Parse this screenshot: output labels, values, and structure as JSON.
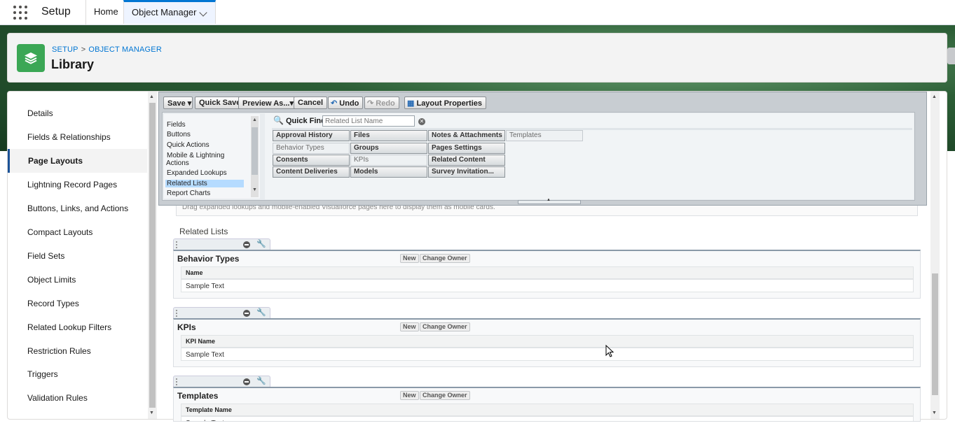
{
  "topbar": {
    "app_name": "Setup",
    "tabs": [
      {
        "label": "Home"
      },
      {
        "label": "Object Manager"
      }
    ]
  },
  "header": {
    "breadcrumb": [
      "SETUP",
      "OBJECT MANAGER"
    ],
    "breadcrumb_sep": ">",
    "title": "Library",
    "icon": "layers-icon"
  },
  "sidebar": {
    "items": [
      {
        "label": "Details"
      },
      {
        "label": "Fields & Relationships"
      },
      {
        "label": "Page Layouts",
        "active": true
      },
      {
        "label": "Lightning Record Pages"
      },
      {
        "label": "Buttons, Links, and Actions"
      },
      {
        "label": "Compact Layouts"
      },
      {
        "label": "Field Sets"
      },
      {
        "label": "Object Limits"
      },
      {
        "label": "Record Types"
      },
      {
        "label": "Related Lookup Filters"
      },
      {
        "label": "Restriction Rules"
      },
      {
        "label": "Triggers"
      },
      {
        "label": "Validation Rules"
      }
    ]
  },
  "palette": {
    "toolbar": {
      "save": "Save",
      "quick_save": "Quick Save",
      "preview_as": "Preview As...",
      "cancel": "Cancel",
      "undo": "Undo",
      "redo": "Redo",
      "layout_properties": "Layout Properties"
    },
    "categories": [
      {
        "label": "Fields"
      },
      {
        "label": "Buttons"
      },
      {
        "label": "Quick Actions"
      },
      {
        "label": "Mobile & Lightning"
      },
      {
        "label": "Actions"
      },
      {
        "label": "Expanded Lookups"
      },
      {
        "label": "Related Lists",
        "selected": true
      },
      {
        "label": "Report Charts"
      }
    ],
    "quick_find": {
      "label": "Quick Find",
      "placeholder": "Related List Name"
    },
    "items": [
      {
        "label": "Approval History",
        "used": false
      },
      {
        "label": "Files",
        "used": false
      },
      {
        "label": "Notes & Attachments",
        "used": false
      },
      {
        "label": "Templates",
        "used": true
      },
      {
        "label": "Behavior Types",
        "used": true
      },
      {
        "label": "Groups",
        "used": false
      },
      {
        "label": "Pages Settings",
        "used": false
      },
      {
        "label": "Consents",
        "used": false
      },
      {
        "label": "KPIs",
        "used": true
      },
      {
        "label": "Related Content",
        "used": false
      },
      {
        "label": "Content Deliveries",
        "used": false
      },
      {
        "label": "Models",
        "used": false
      },
      {
        "label": "Survey Invitation...",
        "used": false
      }
    ],
    "hint_text": "Drag expanded lookups and mobile-enabled Visualforce pages here to display them as mobile cards."
  },
  "layout": {
    "related_lists_heading": "Related Lists",
    "sections": [
      {
        "title": "Behavior Types",
        "column": "Name",
        "value": "Sample Text",
        "new_label": "New",
        "change_owner_label": "Change Owner"
      },
      {
        "title": "KPIs",
        "column": "KPI Name",
        "value": "Sample Text",
        "new_label": "New",
        "change_owner_label": "Change Owner"
      },
      {
        "title": "Templates",
        "column": "Template Name",
        "value": "Sample Text",
        "new_label": "New",
        "change_owner_label": "Change Owner"
      }
    ]
  },
  "colors": {
    "accent": "#0176d3",
    "object_icon": "#3ba755",
    "active_indicator": "#1b5297"
  }
}
